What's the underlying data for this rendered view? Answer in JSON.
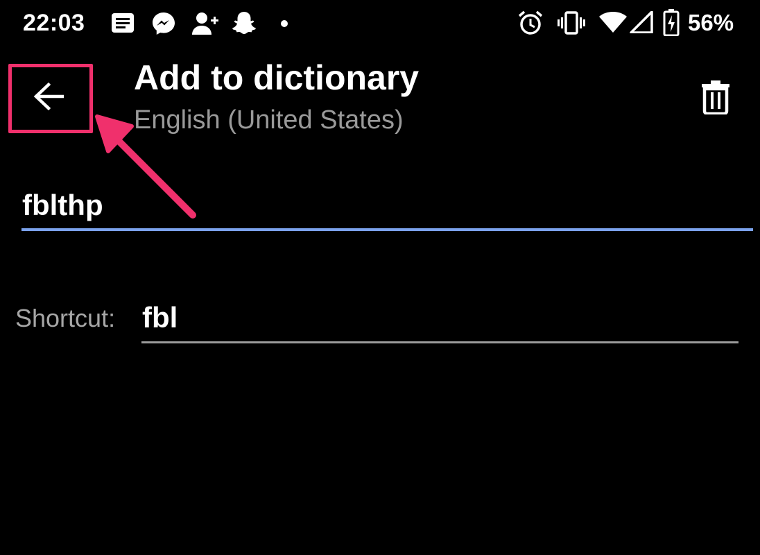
{
  "status_bar": {
    "time": "22:03",
    "battery_percent": "56%",
    "left_icons": [
      "news-icon",
      "messenger-icon",
      "add-contact-icon",
      "snapchat-icon",
      "dot-icon"
    ],
    "right_icons": [
      "alarm-icon",
      "vibrate-icon",
      "wifi-icon",
      "signal-icon",
      "battery-charging-icon"
    ]
  },
  "app_bar": {
    "title": "Add to dictionary",
    "subtitle": "English (United States)",
    "back_icon": "back-arrow-icon",
    "delete_icon": "trash-icon"
  },
  "word_field": {
    "value": "fblthp"
  },
  "shortcut": {
    "label": "Shortcut:",
    "value": "fbl"
  },
  "colors": {
    "background": "#000000",
    "accent_underline": "#7ba2ec",
    "annotation": "#f0306c",
    "secondary_text": "#9a9a9a"
  }
}
